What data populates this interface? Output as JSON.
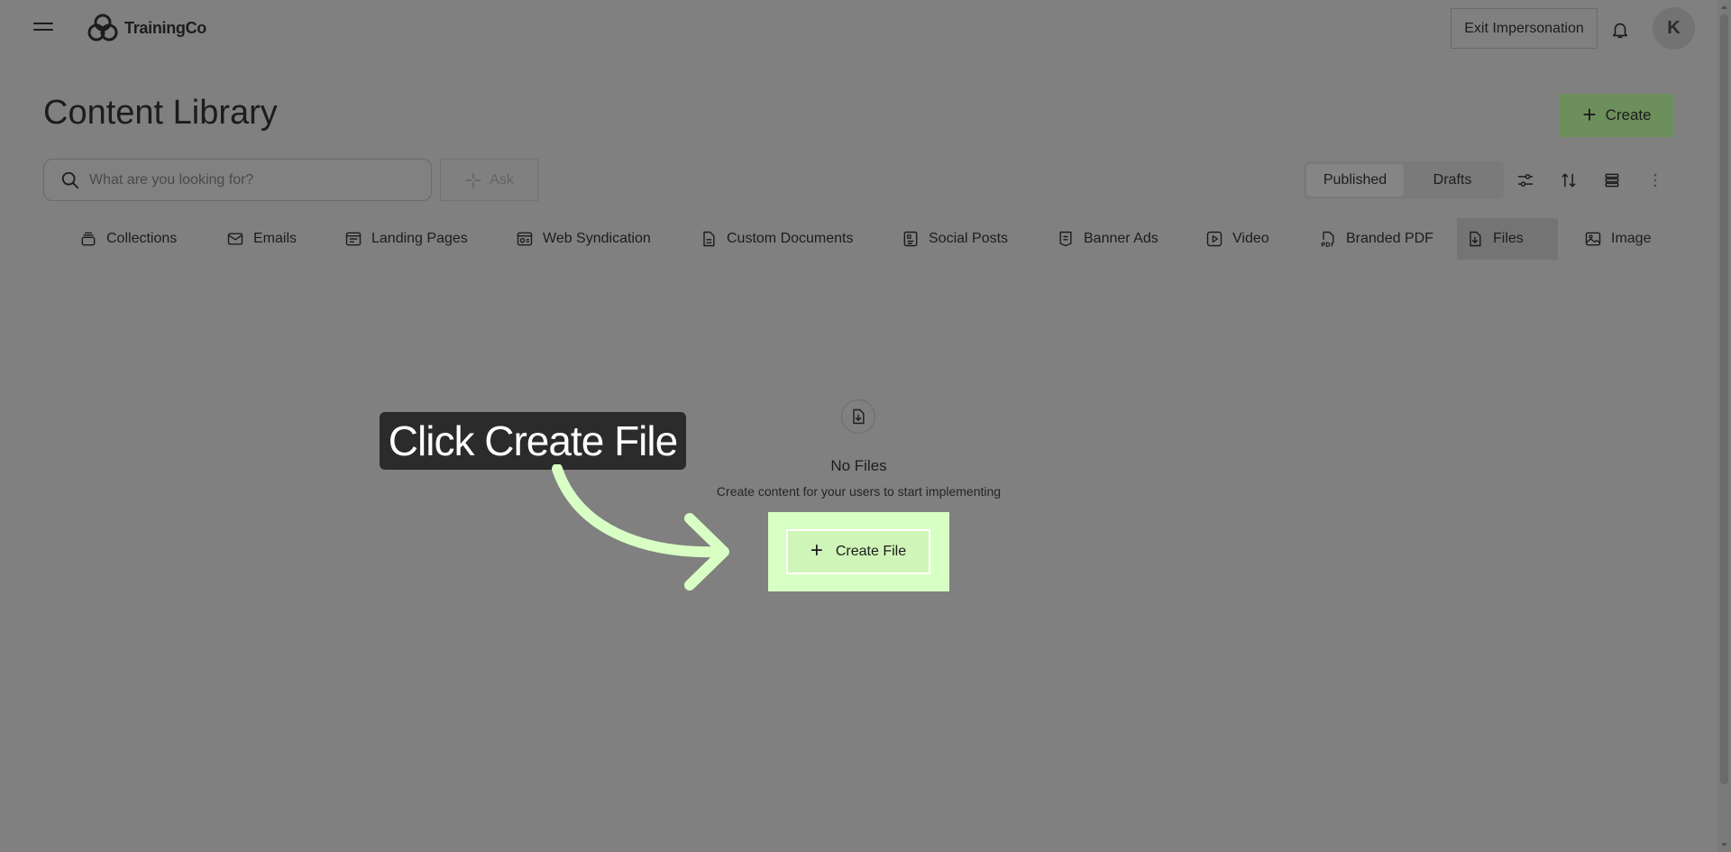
{
  "app": {
    "brand": "TrainingCo"
  },
  "header": {
    "exit_label": "Exit Impersonation",
    "avatar_initial": "K"
  },
  "page": {
    "title": "Content Library",
    "create_label": "Create"
  },
  "search": {
    "placeholder": "What are you looking for?",
    "ask_label": "Ask"
  },
  "status_toggle": {
    "options": [
      "Published",
      "Drafts"
    ],
    "selected": "Published"
  },
  "tabs": [
    {
      "label": "Collections",
      "icon": "collections-icon"
    },
    {
      "label": "Emails",
      "icon": "mail-icon"
    },
    {
      "label": "Landing Pages",
      "icon": "landing-page-icon"
    },
    {
      "label": "Web Syndication",
      "icon": "web-syndication-icon"
    },
    {
      "label": "Custom Documents",
      "icon": "document-icon"
    },
    {
      "label": "Social Posts",
      "icon": "social-post-icon"
    },
    {
      "label": "Banner Ads",
      "icon": "banner-ad-icon"
    },
    {
      "label": "Video",
      "icon": "video-icon"
    },
    {
      "label": "Branded PDF",
      "icon": "pdf-icon"
    },
    {
      "label": "Files",
      "icon": "file-download-icon",
      "active": true
    },
    {
      "label": "Image",
      "icon": "image-icon"
    }
  ],
  "empty_state": {
    "title": "No Files",
    "subtitle": "Create content for your users to start implementing",
    "button_label": "Create File"
  },
  "callout": {
    "text": "Click Create File"
  },
  "colors": {
    "overlay": "#808080",
    "highlight": "#d8ffc4",
    "create_button": "#6d8f5b"
  }
}
